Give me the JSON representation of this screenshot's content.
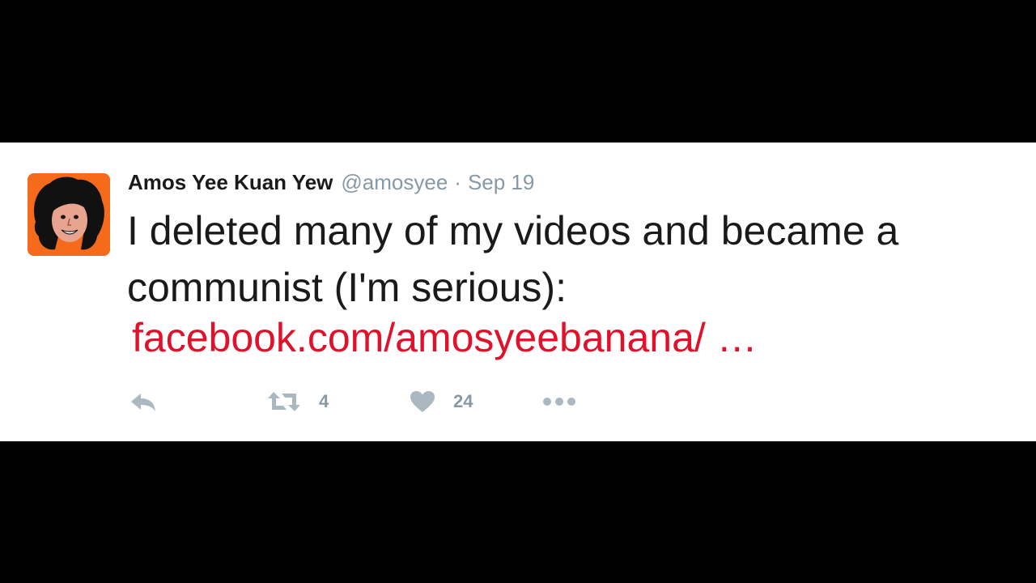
{
  "tweet": {
    "author": {
      "display_name": "Amos Yee Kuan Yew",
      "handle": "@amosyee",
      "avatar_icon": "cartoon-avatar-icon"
    },
    "separator": "·",
    "timestamp": "Sep 19",
    "text": "I deleted many of my videos and became a communist (I'm serious):",
    "link_text": "facebook.com/amosyeebanana/ …",
    "actions": {
      "reply_icon": "reply-icon",
      "retweet_icon": "retweet-icon",
      "retweet_count": "4",
      "like_icon": "heart-icon",
      "like_count": "24",
      "more_icon": "more-icon"
    }
  },
  "colors": {
    "background": "#000000",
    "card": "#ffffff",
    "link": "#e0112b",
    "muted": "#8899a6",
    "avatar_bg": "#f56a1b"
  }
}
